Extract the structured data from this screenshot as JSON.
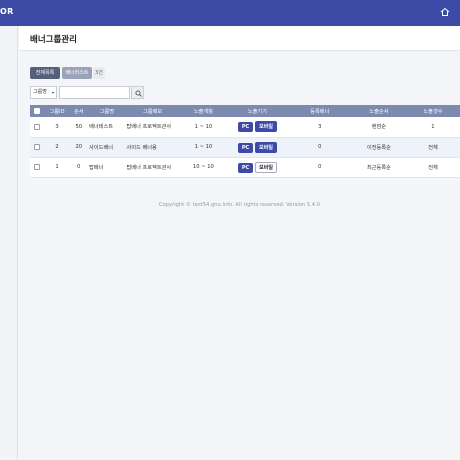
{
  "header": {
    "brand": "OR"
  },
  "page": {
    "title": "배너그룹관리"
  },
  "filters": {
    "all_label": "전체목록",
    "list_label": "배너리스트",
    "count_label": "3건"
  },
  "search": {
    "select_value": "그룹명",
    "select_arrow": "▾",
    "input_value": ""
  },
  "table": {
    "headers": [
      "그룹ID",
      "순서",
      "그룹명",
      "그룹메모",
      "노출개월",
      "노출기기",
      "등록배너",
      "노출순서",
      "노출갯수"
    ],
    "rows": [
      {
        "id": "3",
        "order": "50",
        "name": "배너테스트",
        "memo": "탑배너 프로젝트관사",
        "months": "1 ~ 10",
        "pc": "PC",
        "mobile": "모바일",
        "mobile_active": true,
        "banners": "3",
        "sort": "랜덤순",
        "count": "1"
      },
      {
        "id": "2",
        "order": "20",
        "name": "사이드배너",
        "memo": "사이드 배너용",
        "months": "1 ~ 10",
        "pc": "PC",
        "mobile": "모바일",
        "mobile_active": true,
        "banners": "0",
        "sort": "이전등록순",
        "count": "전체"
      },
      {
        "id": "1",
        "order": "0",
        "name": "탑배너",
        "memo": "탑배너 프로젝트관사",
        "months": "10 ~ 10",
        "pc": "PC",
        "mobile": "모바일",
        "mobile_active": false,
        "banners": "0",
        "sort": "최근등록순",
        "count": "전체"
      }
    ]
  },
  "footer": {
    "text": "Copyright © test54.gnu.info. All rights reserved. Version 5.4.0"
  },
  "colors": {
    "accent": "#3e4ba6",
    "table_header": "#7c8aaf"
  },
  "icons": {
    "home": "home-icon",
    "search": "search-icon"
  }
}
